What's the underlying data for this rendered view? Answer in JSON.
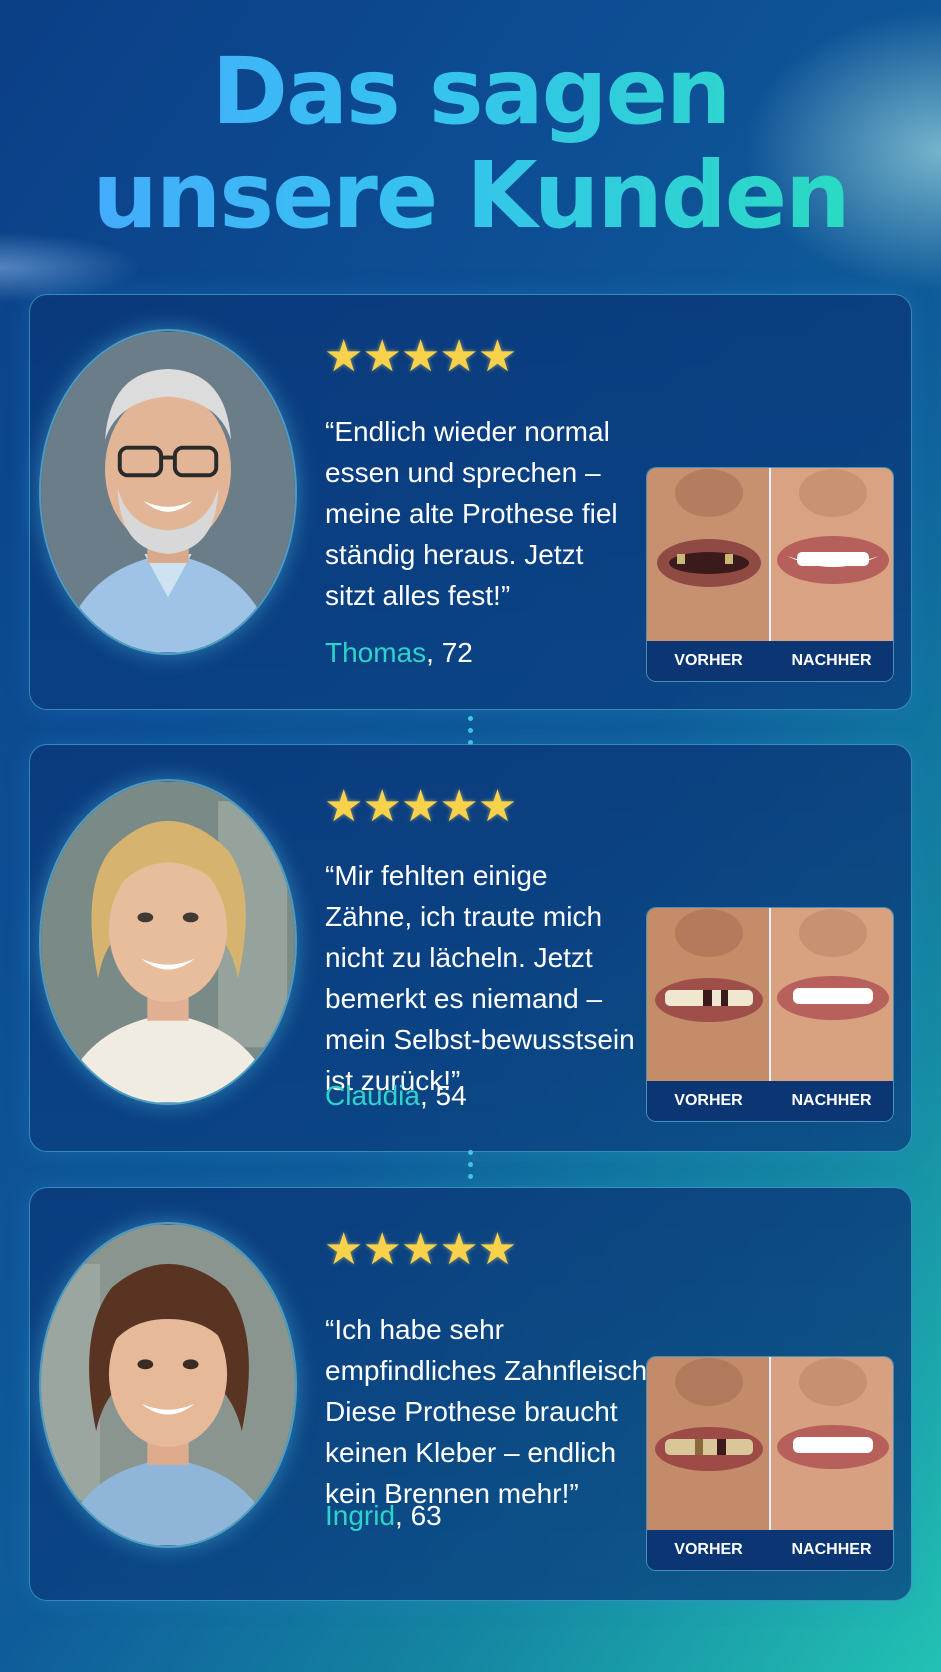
{
  "headline": {
    "line1": "Das sagen",
    "line2": "unsere Kunden"
  },
  "testimonials": [
    {
      "stars": "★★★★★",
      "rating": 5,
      "quote": "“Endlich wieder normal essen und sprechen – meine alte Prothese fiel ständig heraus. Jetzt sitzt alles fest!”",
      "name": "Thomas",
      "age": ", 72",
      "before_label": "VORHER",
      "after_label": "NACHHER"
    },
    {
      "stars": "★★★★★",
      "rating": 5,
      "quote": "“Mir fehlten einige Zähne, ich traute mich nicht zu lächeln. Jetzt bemerkt es niemand – mein Selbst-bewusstsein ist zurück!”",
      "name": "Claudia",
      "age": ", 54",
      "before_label": "VORHER",
      "after_label": "NACHHER"
    },
    {
      "stars": "★★★★★",
      "rating": 5,
      "quote": "“Ich habe sehr empfindliches Zahnfleisch. Diese Prothese braucht keinen Kleber – endlich kein Brennen mehr!”",
      "name": "Ingrid",
      "age": ", 63",
      "before_label": "VORHER",
      "after_label": "NACHHER"
    }
  ],
  "colors": {
    "accent_name": "#2fd3c9",
    "star": "#f7d24a",
    "headline_start": "#47a6ff",
    "headline_end": "#27e0b8"
  }
}
